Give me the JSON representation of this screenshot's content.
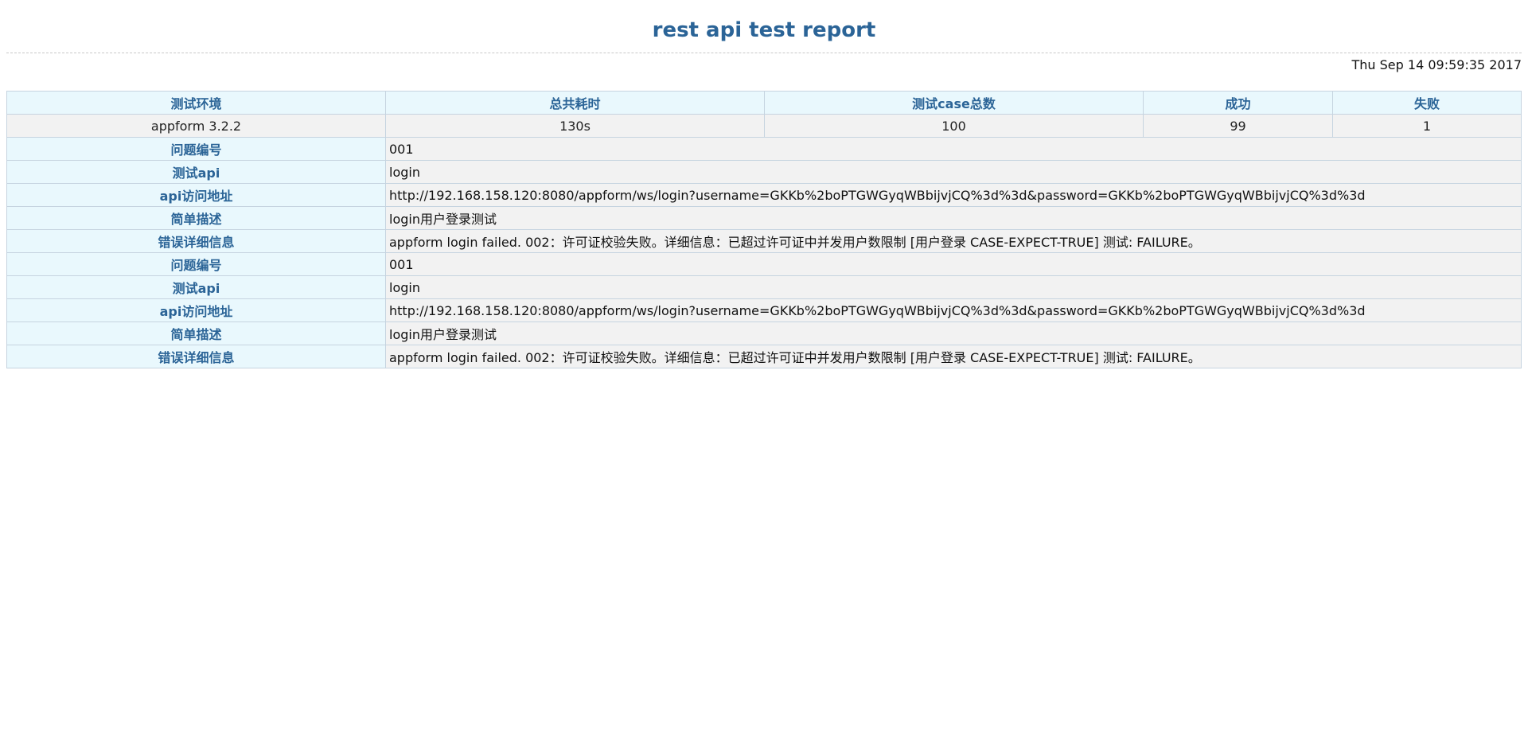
{
  "report": {
    "title": "rest api test report",
    "timestamp": "Thu Sep 14 09:59:35 2017"
  },
  "summary": {
    "headers": [
      "测试环境",
      "总共耗时",
      "测试case总数",
      "成功",
      "失败"
    ],
    "values": [
      "appform 3.2.2",
      "130s",
      "100",
      "99",
      "1"
    ]
  },
  "issues": [
    {
      "rows": [
        {
          "label": "问题编号",
          "value": "001"
        },
        {
          "label": "测试api",
          "value": "login"
        },
        {
          "label": "api访问地址",
          "value": "http://192.168.158.120:8080/appform/ws/login?username=GKKb%2boPTGWGyqWBbijvjCQ%3d%3d&password=GKKb%2boPTGWGyqWBbijvjCQ%3d%3d"
        },
        {
          "label": "简单描述",
          "value": "login用户登录测试"
        },
        {
          "label": "错误详细信息",
          "value": "appform login failed. 002：许可证校验失败。详细信息：已超过许可证中并发用户数限制 [用户登录 CASE-EXPECT-TRUE] 测试: FAILURE。"
        }
      ]
    },
    {
      "rows": [
        {
          "label": "问题编号",
          "value": "001"
        },
        {
          "label": "测试api",
          "value": "login"
        },
        {
          "label": "api访问地址",
          "value": "http://192.168.158.120:8080/appform/ws/login?username=GKKb%2boPTGWGyqWBbijvjCQ%3d%3d&password=GKKb%2boPTGWGyqWBbijvjCQ%3d%3d"
        },
        {
          "label": "简单描述",
          "value": "login用户登录测试"
        },
        {
          "label": "错误详细信息",
          "value": "appform login failed. 002：许可证校验失败。详细信息：已超过许可证中并发用户数限制 [用户登录 CASE-EXPECT-TRUE] 测试: FAILURE。"
        }
      ]
    }
  ],
  "colors": {
    "header_text": "#2b6497",
    "header_bg": "#e9f8fd",
    "cell_bg": "#f2f2f2",
    "border": "#c6d4e0"
  }
}
